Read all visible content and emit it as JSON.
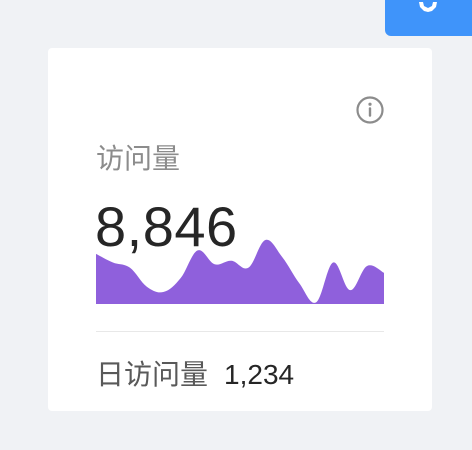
{
  "corner_button": {
    "icon": "settings-icon",
    "color": "#3f94fa"
  },
  "card": {
    "title": "访问量",
    "info_icon": "info-icon",
    "value": "8,846",
    "footer": {
      "label": "日访问量",
      "value": "1,234"
    }
  },
  "chart_data": {
    "type": "area",
    "color": "#8f60dc",
    "values": [
      58,
      48,
      42,
      20,
      14,
      30,
      62,
      46,
      50,
      42,
      74,
      54,
      24,
      2,
      48,
      16,
      44,
      36
    ]
  }
}
